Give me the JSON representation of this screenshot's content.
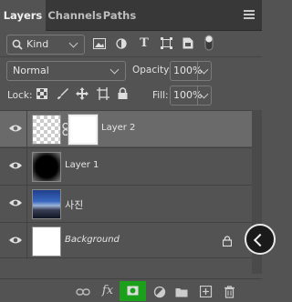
{
  "tabs": [
    {
      "label": "Layers",
      "active": true
    },
    {
      "label": "Channels",
      "active": false
    },
    {
      "label": "Paths",
      "active": false
    }
  ],
  "filter": {
    "value": "Kind",
    "icons": [
      "image-filter-icon",
      "adjustment-filter-icon",
      "type-filter-icon",
      "shape-filter-icon",
      "smart-object-filter-icon",
      "filter-toggle-icon"
    ]
  },
  "blend": {
    "mode": "Normal",
    "opacity_label": "Opacity:",
    "opacity": "100%"
  },
  "lock": {
    "label": "Lock:",
    "fill_label": "Fill:",
    "fill": "100%"
  },
  "layers": [
    {
      "name": "Layer 2",
      "selected": true,
      "visible": true,
      "has_mask": true,
      "italic": false
    },
    {
      "name": "Layer 1",
      "selected": false,
      "visible": true,
      "has_mask": false,
      "italic": false
    },
    {
      "name": "사진",
      "selected": false,
      "visible": true,
      "has_mask": false,
      "italic": false
    },
    {
      "name": "Background",
      "selected": false,
      "visible": true,
      "has_mask": false,
      "italic": true,
      "locked": true
    }
  ],
  "bottom_icons": [
    "link-layers-icon",
    "fx-icon",
    "add-mask-icon",
    "adjustment-layer-icon",
    "new-group-icon",
    "new-layer-icon",
    "delete-icon"
  ],
  "colors": {
    "panel": "#535353",
    "selected_row": "#6a6a6a",
    "tab_bar": "#383838",
    "mask_highlight": "#1ca01c"
  }
}
